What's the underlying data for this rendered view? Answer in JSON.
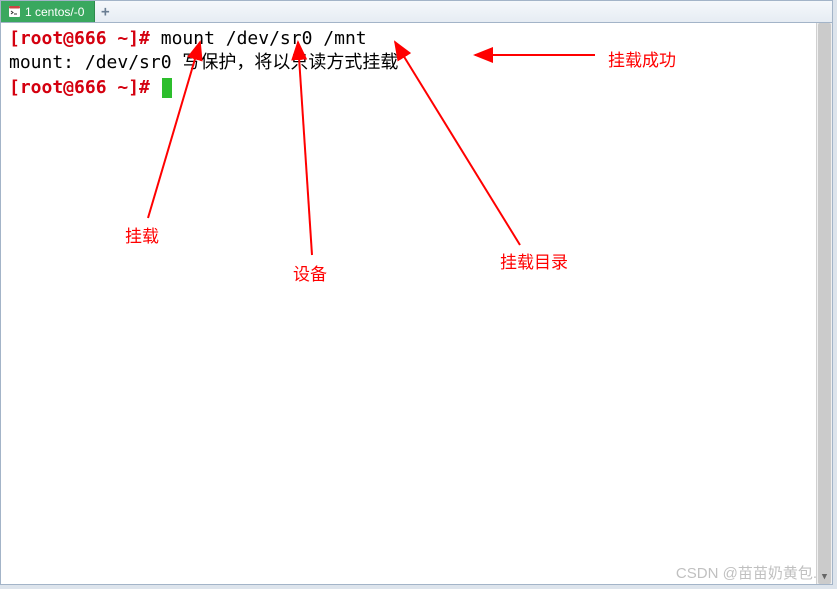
{
  "tab": {
    "title": "1 centos/-0"
  },
  "terminal": {
    "line1_prompt": "[root@666 ~]#",
    "line1_cmd": " mount /dev/sr0 /mnt",
    "line2": "mount: /dev/sr0 写保护，将以只读方式挂载",
    "line3_prompt": "[root@666 ~]#",
    "line3_cmd": " "
  },
  "annotations": {
    "mount_cmd": "挂载",
    "device": "设备",
    "mount_dir": "挂载目录",
    "mount_success": "挂载成功"
  },
  "watermark": "CSDN @苗苗奶黄包."
}
